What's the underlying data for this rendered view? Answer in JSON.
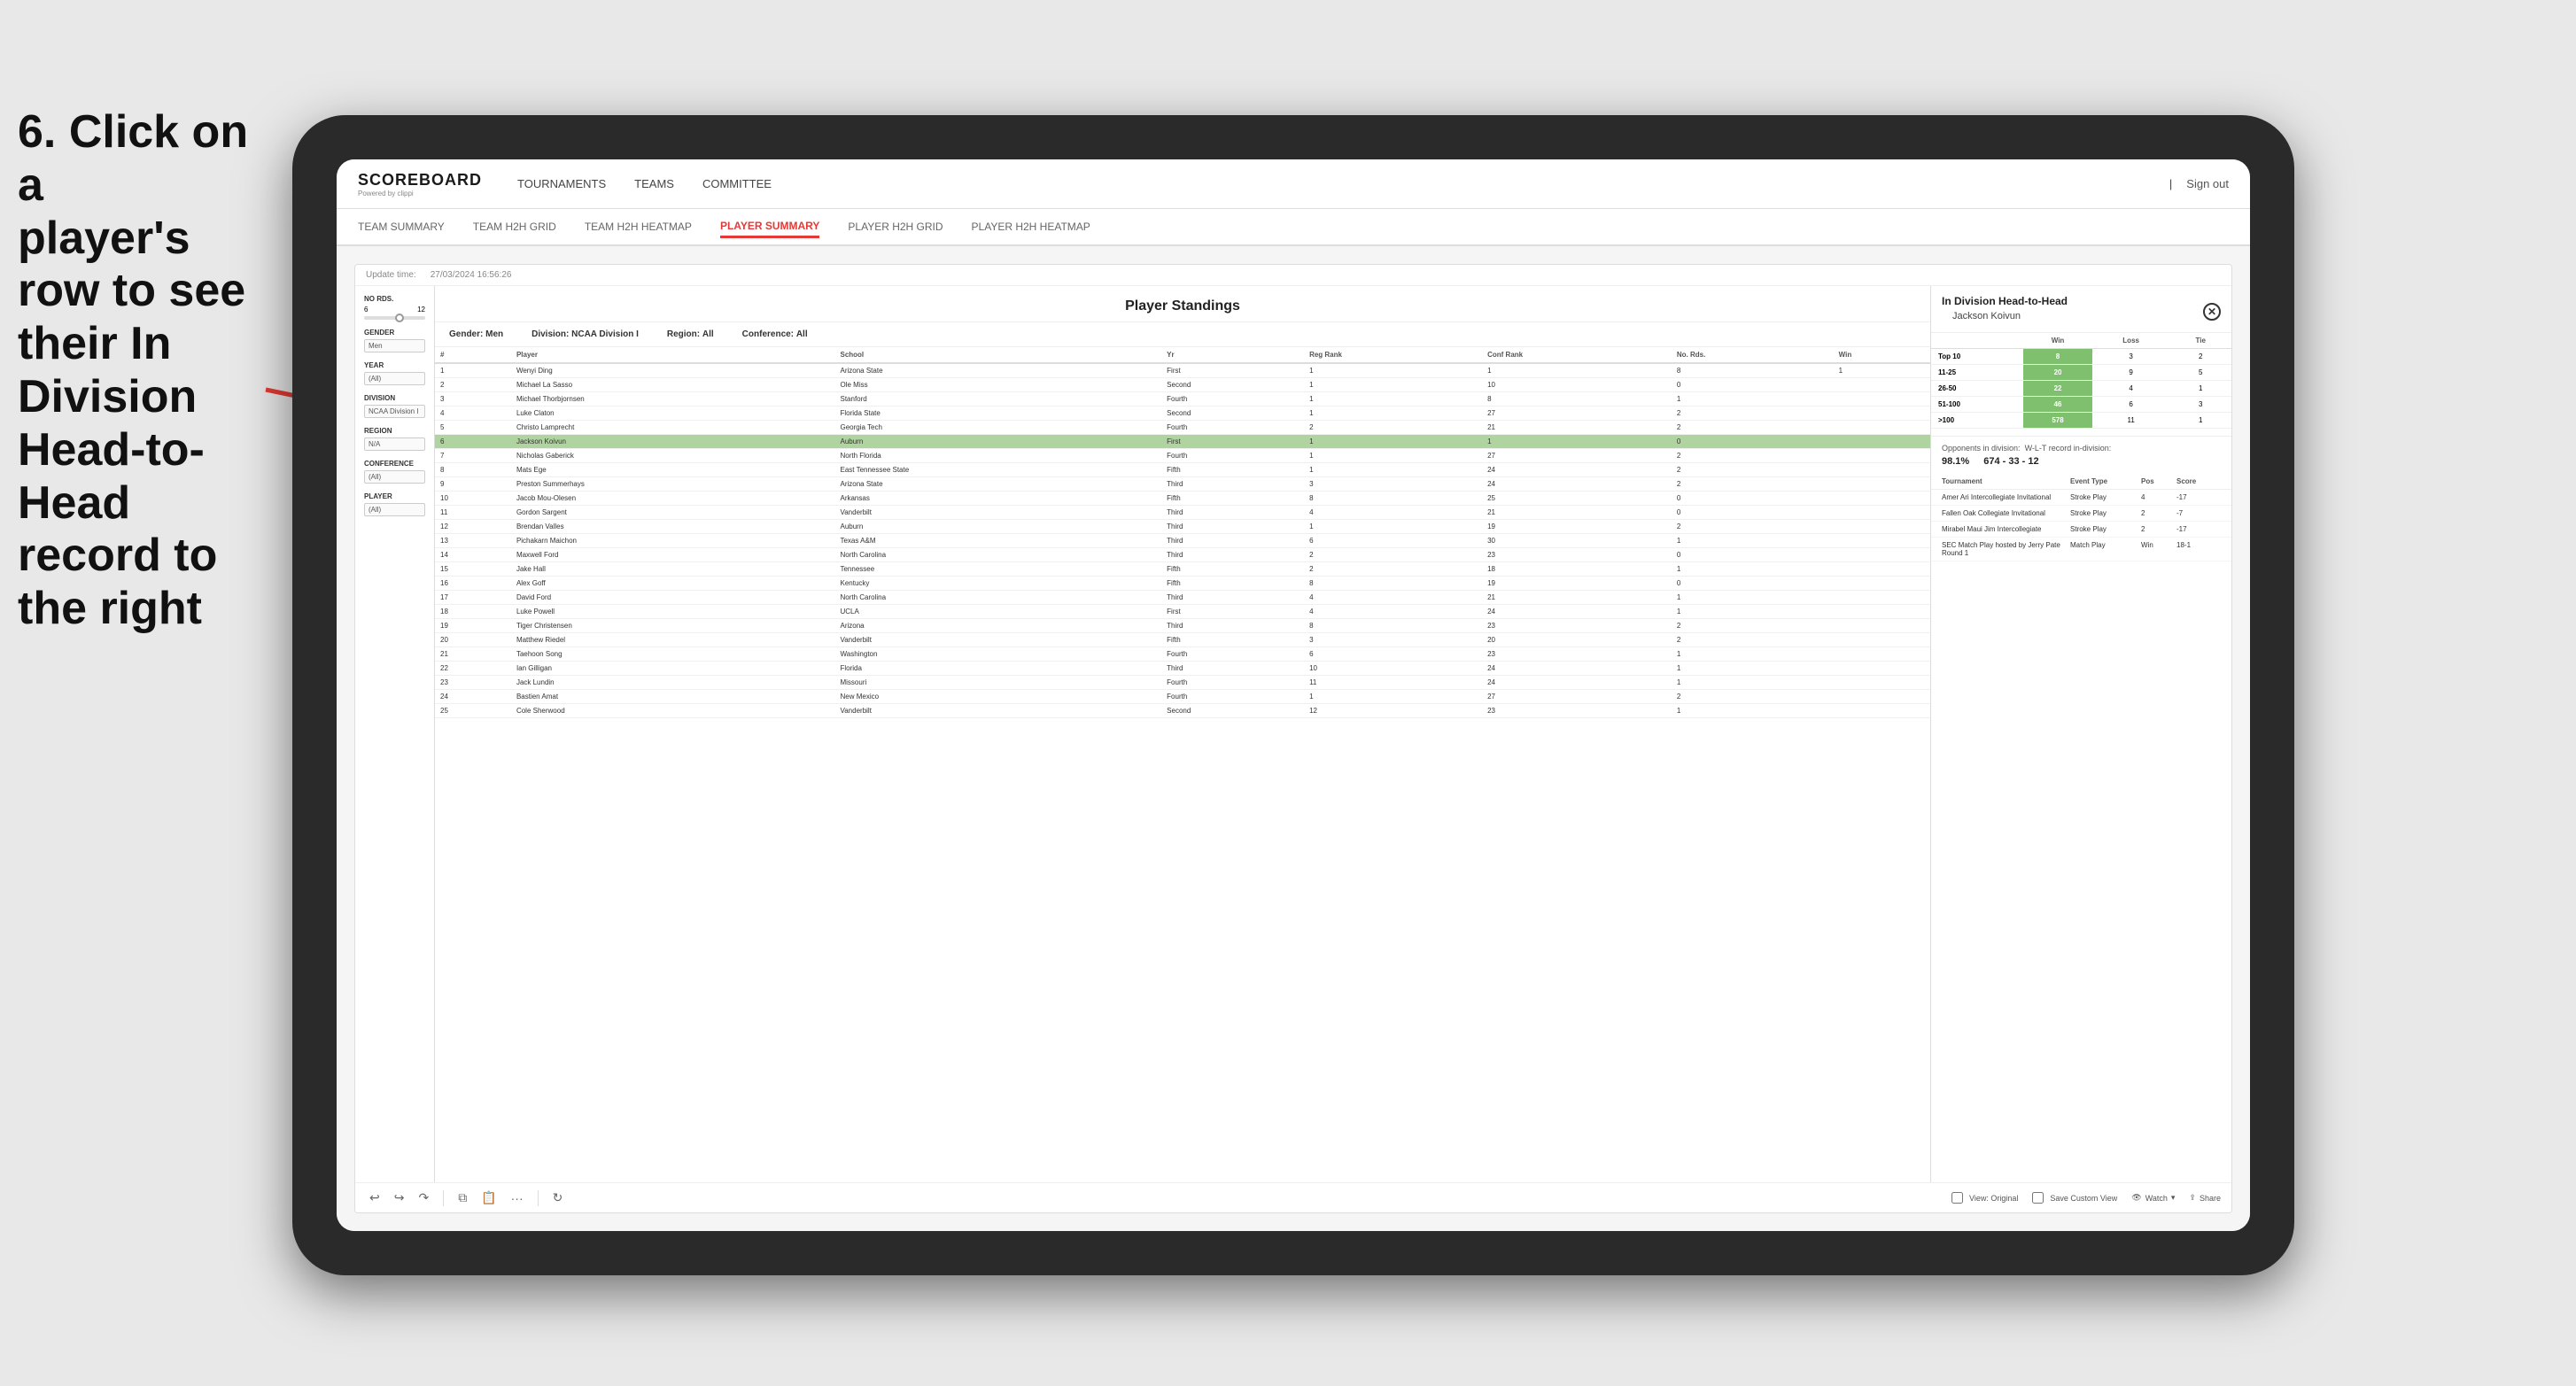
{
  "instruction": {
    "line1": "6. Click on a",
    "line2": "player's row to see",
    "line3": "their In Division",
    "line4": "Head-to-Head",
    "line5": "record to the right"
  },
  "navbar": {
    "logo": "SCOREBOARD",
    "logo_sub": "Powered by clippi",
    "nav_items": [
      "TOURNAMENTS",
      "TEAMS",
      "COMMITTEE"
    ],
    "sign_out": "Sign out"
  },
  "subnav": {
    "items": [
      "TEAM SUMMARY",
      "TEAM H2H GRID",
      "TEAM H2H HEATMAP",
      "PLAYER SUMMARY",
      "PLAYER H2H GRID",
      "PLAYER H2H HEATMAP"
    ],
    "active": "PLAYER SUMMARY"
  },
  "pbi": {
    "update_label": "Update time:",
    "update_time": "27/03/2024 16:56:26",
    "standings_title": "Player Standings",
    "gender_label": "Gender:",
    "gender_value": "Men",
    "division_label": "Division:",
    "division_value": "NCAA Division I",
    "region_label": "Region:",
    "region_value": "All",
    "conference_label": "Conference:",
    "conference_value": "All"
  },
  "filters": {
    "rounds_label": "No Rds.",
    "rounds_min": "6",
    "rounds_max": "12",
    "gender_label": "Gender",
    "gender_value": "Men",
    "year_label": "Year",
    "year_value": "(All)",
    "division_label": "Division",
    "division_value": "NCAA Division I",
    "region_label": "Region",
    "region_value": "N/A",
    "conference_label": "Conference",
    "conference_value": "(All)",
    "player_label": "Player",
    "player_value": "(All)"
  },
  "table": {
    "headers": [
      "#",
      "Player",
      "School",
      "Yr",
      "Reg Rank",
      "Conf Rank",
      "No. Rds.",
      "Win"
    ],
    "rows": [
      {
        "num": "1",
        "player": "Wenyi Ding",
        "school": "Arizona State",
        "yr": "First",
        "reg": "1",
        "conf": "1",
        "rds": "8",
        "win": "1",
        "highlight": false
      },
      {
        "num": "2",
        "player": "Michael La Sasso",
        "school": "Ole Miss",
        "yr": "Second",
        "reg": "1",
        "conf": "10",
        "rds": "0",
        "win": "",
        "highlight": false
      },
      {
        "num": "3",
        "player": "Michael Thorbjornsen",
        "school": "Stanford",
        "yr": "Fourth",
        "reg": "1",
        "conf": "8",
        "rds": "1",
        "win": "",
        "highlight": false
      },
      {
        "num": "4",
        "player": "Luke Claton",
        "school": "Florida State",
        "yr": "Second",
        "reg": "1",
        "conf": "27",
        "rds": "2",
        "win": "",
        "highlight": false
      },
      {
        "num": "5",
        "player": "Christo Lamprecht",
        "school": "Georgia Tech",
        "yr": "Fourth",
        "reg": "2",
        "conf": "21",
        "rds": "2",
        "win": "",
        "highlight": false
      },
      {
        "num": "6",
        "player": "Jackson Koivun",
        "school": "Auburn",
        "yr": "First",
        "reg": "1",
        "conf": "1",
        "rds": "0",
        "win": "",
        "highlight": true
      },
      {
        "num": "7",
        "player": "Nicholas Gaberick",
        "school": "North Florida",
        "yr": "Fourth",
        "reg": "1",
        "conf": "27",
        "rds": "2",
        "win": "",
        "highlight": false
      },
      {
        "num": "8",
        "player": "Mats Ege",
        "school": "East Tennessee State",
        "yr": "Fifth",
        "reg": "1",
        "conf": "24",
        "rds": "2",
        "win": "",
        "highlight": false
      },
      {
        "num": "9",
        "player": "Preston Summerhays",
        "school": "Arizona State",
        "yr": "Third",
        "reg": "3",
        "conf": "24",
        "rds": "2",
        "win": "",
        "highlight": false
      },
      {
        "num": "10",
        "player": "Jacob Mou-Olesen",
        "school": "Arkansas",
        "yr": "Fifth",
        "reg": "8",
        "conf": "25",
        "rds": "0",
        "win": "",
        "highlight": false
      },
      {
        "num": "11",
        "player": "Gordon Sargent",
        "school": "Vanderbilt",
        "yr": "Third",
        "reg": "4",
        "conf": "21",
        "rds": "0",
        "win": "",
        "highlight": false
      },
      {
        "num": "12",
        "player": "Brendan Valles",
        "school": "Auburn",
        "yr": "Third",
        "reg": "1",
        "conf": "19",
        "rds": "2",
        "win": "",
        "highlight": false
      },
      {
        "num": "13",
        "player": "Pichakarn Maichon",
        "school": "Texas A&M",
        "yr": "Third",
        "reg": "6",
        "conf": "30",
        "rds": "1",
        "win": "",
        "highlight": false
      },
      {
        "num": "14",
        "player": "Maxwell Ford",
        "school": "North Carolina",
        "yr": "Third",
        "reg": "2",
        "conf": "23",
        "rds": "0",
        "win": "",
        "highlight": false
      },
      {
        "num": "15",
        "player": "Jake Hall",
        "school": "Tennessee",
        "yr": "Fifth",
        "reg": "2",
        "conf": "18",
        "rds": "1",
        "win": "",
        "highlight": false
      },
      {
        "num": "16",
        "player": "Alex Goff",
        "school": "Kentucky",
        "yr": "Fifth",
        "reg": "8",
        "conf": "19",
        "rds": "0",
        "win": "",
        "highlight": false
      },
      {
        "num": "17",
        "player": "David Ford",
        "school": "North Carolina",
        "yr": "Third",
        "reg": "4",
        "conf": "21",
        "rds": "1",
        "win": "",
        "highlight": false
      },
      {
        "num": "18",
        "player": "Luke Powell",
        "school": "UCLA",
        "yr": "First",
        "reg": "4",
        "conf": "24",
        "rds": "1",
        "win": "",
        "highlight": false
      },
      {
        "num": "19",
        "player": "Tiger Christensen",
        "school": "Arizona",
        "yr": "Third",
        "reg": "8",
        "conf": "23",
        "rds": "2",
        "win": "",
        "highlight": false
      },
      {
        "num": "20",
        "player": "Matthew Riedel",
        "school": "Vanderbilt",
        "yr": "Fifth",
        "reg": "3",
        "conf": "20",
        "rds": "2",
        "win": "",
        "highlight": false
      },
      {
        "num": "21",
        "player": "Taehoon Song",
        "school": "Washington",
        "yr": "Fourth",
        "reg": "6",
        "conf": "23",
        "rds": "1",
        "win": "",
        "highlight": false
      },
      {
        "num": "22",
        "player": "Ian Gilligan",
        "school": "Florida",
        "yr": "Third",
        "reg": "10",
        "conf": "24",
        "rds": "1",
        "win": "",
        "highlight": false
      },
      {
        "num": "23",
        "player": "Jack Lundin",
        "school": "Missouri",
        "yr": "Fourth",
        "reg": "11",
        "conf": "24",
        "rds": "1",
        "win": "",
        "highlight": false
      },
      {
        "num": "24",
        "player": "Bastien Amat",
        "school": "New Mexico",
        "yr": "Fourth",
        "reg": "1",
        "conf": "27",
        "rds": "2",
        "win": "",
        "highlight": false
      },
      {
        "num": "25",
        "player": "Cole Sherwood",
        "school": "Vanderbilt",
        "yr": "Second",
        "reg": "12",
        "conf": "23",
        "rds": "1",
        "win": "",
        "highlight": false
      }
    ]
  },
  "h2h": {
    "title": "In Division Head-to-Head",
    "player": "Jackson Koivun",
    "table_headers": [
      "",
      "Win",
      "Loss",
      "Tie"
    ],
    "rows": [
      {
        "range": "Top 10",
        "win": "8",
        "loss": "3",
        "tie": "2"
      },
      {
        "range": "11-25",
        "win": "20",
        "loss": "9",
        "tie": "5"
      },
      {
        "range": "26-50",
        "win": "22",
        "loss": "4",
        "tie": "1"
      },
      {
        "range": "51-100",
        "win": "46",
        "loss": "6",
        "tie": "3"
      },
      {
        "range": ">100",
        "win": "578",
        "loss": "11",
        "tie": "1"
      }
    ],
    "opponents_label": "Opponents in division:",
    "wl_label": "W-L-T record in-division:",
    "opponents_pct": "98.1%",
    "wl_record": "674 - 33 - 12",
    "tour_headers": [
      "Tournament",
      "Event Type",
      "Pos",
      "Score"
    ],
    "tournaments": [
      {
        "name": "Amer Ari Intercollegiate Invitational",
        "type": "Stroke Play",
        "pos": "4",
        "score": "-17"
      },
      {
        "name": "Fallen Oak Collegiate Invitational",
        "type": "Stroke Play",
        "pos": "2",
        "score": "-7"
      },
      {
        "name": "Mirabel Maui Jim Intercollegiate",
        "type": "Stroke Play",
        "pos": "2",
        "score": "-17"
      },
      {
        "name": "SEC Match Play hosted by Jerry Pate Round 1",
        "type": "Match Play",
        "pos": "Win",
        "score": "18-1"
      }
    ]
  },
  "toolbar": {
    "view_original": "View: Original",
    "save_custom": "Save Custom View",
    "watch": "Watch",
    "share": "Share"
  }
}
